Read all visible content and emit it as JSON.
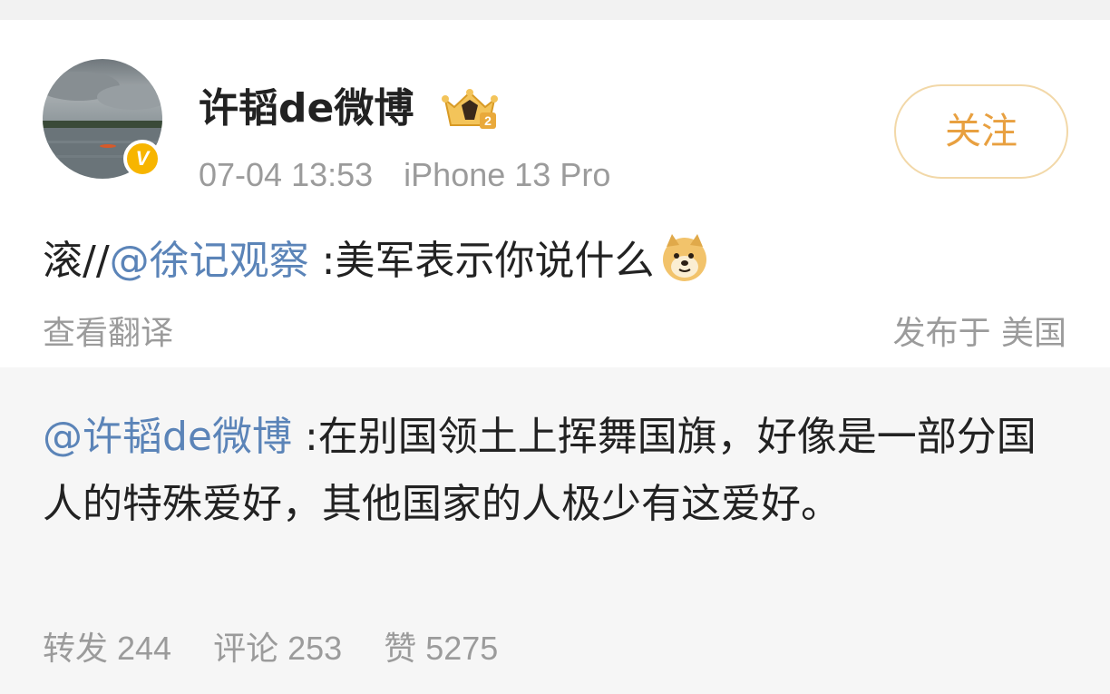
{
  "post": {
    "author": "许韬de微博",
    "author_badge_icon": "crown-level-icon",
    "verified_icon": "verified-v-icon",
    "verified_label": "V",
    "time": "07-04 13:53",
    "device": "iPhone 13 Pro",
    "follow_label": "关注",
    "text_prefix": "滚//",
    "mention": "@徐记观察",
    "text_suffix": " :美军表示你说什么",
    "emoji_icon": "doge-icon",
    "translate_label": "查看翻译",
    "location": "发布于 美国"
  },
  "repost": {
    "mention": "@许韬de微博",
    "text": " :在别国领土上挥舞国旗，好像是一部分国人的特殊爱好，其他国家的人极少有这爱好。",
    "stats": {
      "repost_label": "转发",
      "repost_count": "244",
      "comment_label": "评论",
      "comment_count": "253",
      "like_label": "赞",
      "like_count": "5275"
    }
  },
  "colors": {
    "link": "#5b84b8",
    "follow": "#e8a040",
    "muted": "#9b9b9b",
    "repost_bg": "#f6f6f6"
  }
}
